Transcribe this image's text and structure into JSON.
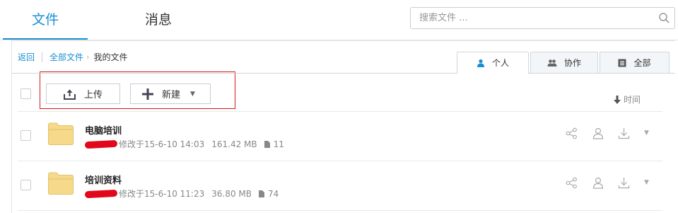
{
  "top_tabs": [
    {
      "label": "文件",
      "active": true
    },
    {
      "label": "消息",
      "active": false
    }
  ],
  "search": {
    "placeholder": "搜索文件 ..."
  },
  "breadcrumb": {
    "back": "返回",
    "all_files": "全部文件",
    "current": "我的文件"
  },
  "view_tabs": [
    {
      "label": "个人",
      "icon": "person-icon",
      "active": true
    },
    {
      "label": "协作",
      "icon": "people-icon",
      "active": false
    },
    {
      "label": "全部",
      "icon": "list-icon",
      "active": false
    }
  ],
  "toolbar": {
    "upload_label": "上传",
    "new_label": "新建",
    "sort_label": "时间"
  },
  "files": [
    {
      "name": "电脑培训",
      "modified": "修改于15-6-10 14:03",
      "size": "161.42 MB",
      "count": "11"
    },
    {
      "name": "培训资料",
      "modified": "修改于15-6-10 11:23",
      "size": "36.80 MB",
      "count": "74"
    }
  ],
  "colors": {
    "accent": "#1a8ed3",
    "highlight": "#d9171d",
    "folder": "#f6d98a"
  }
}
